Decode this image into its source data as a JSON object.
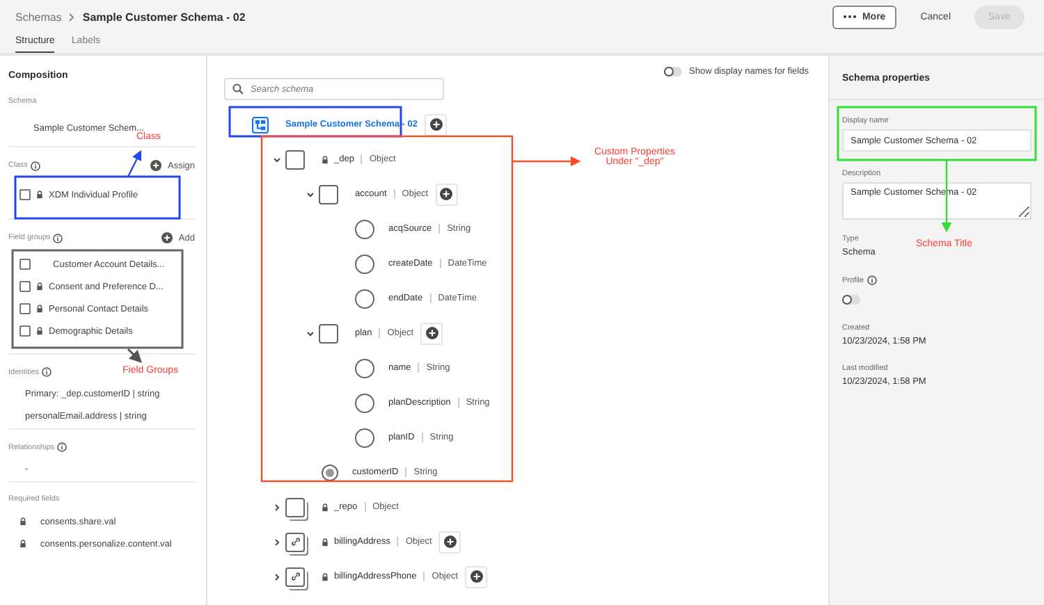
{
  "header": {
    "breadcrumb": [
      "Schemas",
      "Sample Customer Schema - 02"
    ],
    "buttons": [
      {
        "label": "More",
        "kind": "more",
        "disabled": false
      },
      {
        "label": "Cancel",
        "kind": "quiet",
        "disabled": false
      },
      {
        "label": "Save",
        "kind": "primary",
        "disabled": true
      }
    ]
  },
  "tabs": [
    {
      "label": "Structure",
      "selected": true
    },
    {
      "label": "Labels",
      "selected": false
    }
  ],
  "composition": {
    "title": "Composition",
    "schema_label": "Schema",
    "schema_value": "Sample Customer Schem...",
    "class_label": "Class",
    "class_action": "Assign",
    "class_items": [
      {
        "label": "XDM Individual Profile",
        "locked": true,
        "checked": false
      }
    ],
    "field_groups_label": "Field groups",
    "field_groups_action": "Add",
    "field_groups": [
      {
        "label": "Customer Account Details...",
        "locked": false,
        "checked": false
      },
      {
        "label": "Consent and Preference D...",
        "locked": true,
        "checked": false
      },
      {
        "label": "Personal Contact Details",
        "locked": true,
        "checked": false
      },
      {
        "label": "Demographic Details",
        "locked": true,
        "checked": false
      }
    ],
    "identities_label": "Identities",
    "identities": [
      "Primary: _dep.customerID | string",
      "personalEmail.address | string"
    ],
    "relationships_label": "Relationships",
    "relationships": [
      "-"
    ],
    "required_label": "Required fields",
    "required": [
      "consents.share.val",
      "consents.personalize.content.val"
    ]
  },
  "canvas": {
    "search": {
      "placeholder": "Search schema"
    },
    "display_names_toggle": {
      "label": "Show display names for fields",
      "on": false
    },
    "tree": {
      "name": "Sample Customer Schema - 02",
      "kind": "schema",
      "selected": true,
      "add": true,
      "locked": false,
      "children": [
        {
          "name": "_dep",
          "type": "Object",
          "kind": "object",
          "locked": true,
          "expanded": true,
          "add": false,
          "selected": false,
          "children": [
            {
              "name": "account",
              "type": "Object",
              "kind": "object",
              "locked": false,
              "expanded": true,
              "add": true,
              "selected": false,
              "children": [
                {
                  "name": "acqSource",
                  "type": "String",
                  "kind": "field",
                  "locked": false,
                  "add": false,
                  "selected": false
                },
                {
                  "name": "createDate",
                  "type": "DateTime",
                  "kind": "field",
                  "locked": false,
                  "add": false,
                  "selected": false
                },
                {
                  "name": "endDate",
                  "type": "DateTime",
                  "kind": "field",
                  "locked": false,
                  "add": false,
                  "selected": false
                }
              ]
            },
            {
              "name": "plan",
              "type": "Object",
              "kind": "object",
              "locked": false,
              "expanded": true,
              "add": true,
              "selected": false,
              "children": [
                {
                  "name": "name",
                  "type": "String",
                  "kind": "field",
                  "locked": false,
                  "add": false,
                  "selected": false
                },
                {
                  "name": "planDescription",
                  "type": "String",
                  "kind": "field",
                  "locked": false,
                  "add": false,
                  "selected": false
                },
                {
                  "name": "planID",
                  "type": "String",
                  "kind": "field",
                  "locked": false,
                  "add": false,
                  "selected": false
                }
              ]
            },
            {
              "name": "customerID",
              "type": "String",
              "kind": "identity",
              "locked": false,
              "add": false,
              "selected": false
            }
          ]
        },
        {
          "name": "_repo",
          "type": "Object",
          "kind": "object",
          "locked": true,
          "expanded": false,
          "add": false,
          "selected": false
        },
        {
          "name": "billingAddress",
          "type": "Object",
          "kind": "reference",
          "locked": true,
          "expanded": false,
          "add": true,
          "selected": false
        },
        {
          "name": "billingAddressPhone",
          "type": "Object",
          "kind": "reference",
          "locked": true,
          "expanded": false,
          "add": true,
          "selected": false
        }
      ]
    }
  },
  "properties": {
    "title": "Schema properties",
    "display_name_label": "Display name",
    "display_name": "Sample Customer Schema - 02",
    "description_label": "Description",
    "description": "Sample Customer Schema - 02",
    "type_label": "Type",
    "type": "Schema",
    "profile_label": "Profile",
    "profile_on": false,
    "created_label": "Created",
    "created": "10/23/2024, 1:58 PM",
    "modified_label": "Last modified",
    "modified": "10/23/2024, 1:58 PM"
  },
  "annotations": [
    {
      "text": "Class",
      "color": "#ff3b30"
    },
    {
      "text": "Field Groups",
      "color": "#ff3b30"
    },
    {
      "text": "Custom Properties Under \"_dep\"",
      "color": "#ff3b30"
    },
    {
      "text": "Schema Title",
      "color": "#ff3b30"
    }
  ]
}
